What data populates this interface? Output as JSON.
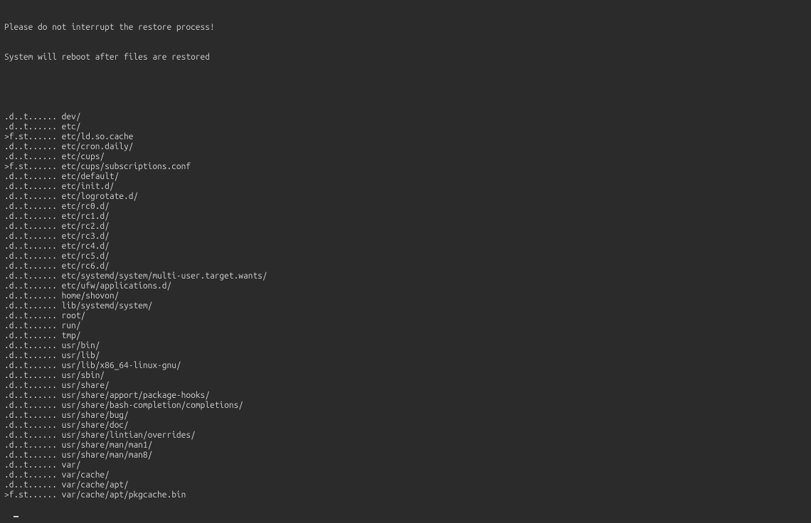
{
  "header": {
    "line1": "Please do not interrupt the restore process!",
    "line2": "System will reboot after files are restored"
  },
  "entries": [
    {
      "flags": ".d..t......",
      "path": "dev/"
    },
    {
      "flags": ".d..t......",
      "path": "etc/"
    },
    {
      "flags": ">f.st......",
      "path": "etc/ld.so.cache"
    },
    {
      "flags": ".d..t......",
      "path": "etc/cron.daily/"
    },
    {
      "flags": ".d..t......",
      "path": "etc/cups/"
    },
    {
      "flags": ">f.st......",
      "path": "etc/cups/subscriptions.conf"
    },
    {
      "flags": ".d..t......",
      "path": "etc/default/"
    },
    {
      "flags": ".d..t......",
      "path": "etc/init.d/"
    },
    {
      "flags": ".d..t......",
      "path": "etc/logrotate.d/"
    },
    {
      "flags": ".d..t......",
      "path": "etc/rc0.d/"
    },
    {
      "flags": ".d..t......",
      "path": "etc/rc1.d/"
    },
    {
      "flags": ".d..t......",
      "path": "etc/rc2.d/"
    },
    {
      "flags": ".d..t......",
      "path": "etc/rc3.d/"
    },
    {
      "flags": ".d..t......",
      "path": "etc/rc4.d/"
    },
    {
      "flags": ".d..t......",
      "path": "etc/rc5.d/"
    },
    {
      "flags": ".d..t......",
      "path": "etc/rc6.d/"
    },
    {
      "flags": ".d..t......",
      "path": "etc/systemd/system/multi-user.target.wants/"
    },
    {
      "flags": ".d..t......",
      "path": "etc/ufw/applications.d/"
    },
    {
      "flags": ".d..t......",
      "path": "home/shovon/"
    },
    {
      "flags": ".d..t......",
      "path": "lib/systemd/system/"
    },
    {
      "flags": ".d..t......",
      "path": "root/"
    },
    {
      "flags": ".d..t......",
      "path": "run/"
    },
    {
      "flags": ".d..t......",
      "path": "tmp/"
    },
    {
      "flags": ".d..t......",
      "path": "usr/bin/"
    },
    {
      "flags": ".d..t......",
      "path": "usr/lib/"
    },
    {
      "flags": ".d..t......",
      "path": "usr/lib/x86_64-linux-gnu/"
    },
    {
      "flags": ".d..t......",
      "path": "usr/sbin/"
    },
    {
      "flags": ".d..t......",
      "path": "usr/share/"
    },
    {
      "flags": ".d..t......",
      "path": "usr/share/apport/package-hooks/"
    },
    {
      "flags": ".d..t......",
      "path": "usr/share/bash-completion/completions/"
    },
    {
      "flags": ".d..t......",
      "path": "usr/share/bug/"
    },
    {
      "flags": ".d..t......",
      "path": "usr/share/doc/"
    },
    {
      "flags": ".d..t......",
      "path": "usr/share/lintian/overrides/"
    },
    {
      "flags": ".d..t......",
      "path": "usr/share/man/man1/"
    },
    {
      "flags": ".d..t......",
      "path": "usr/share/man/man8/"
    },
    {
      "flags": ".d..t......",
      "path": "var/"
    },
    {
      "flags": ".d..t......",
      "path": "var/cache/"
    },
    {
      "flags": ".d..t......",
      "path": "var/cache/apt/"
    },
    {
      "flags": ">f.st......",
      "path": "var/cache/apt/pkgcache.bin"
    }
  ]
}
